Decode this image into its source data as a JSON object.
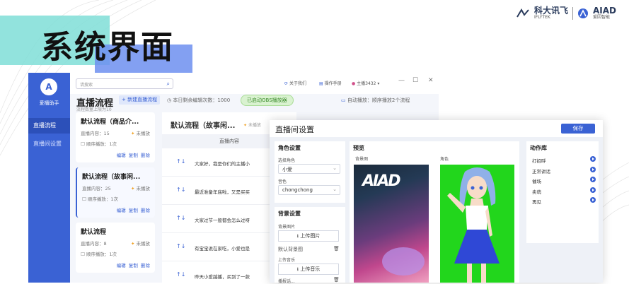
{
  "slide": {
    "title": "系统界面",
    "logo_left_cn": "科大讯飞",
    "logo_left_en": "IFLYTEK",
    "logo_right_en": "AIAD",
    "logo_right_cn": "爱因智能"
  },
  "app": {
    "name": "爱播助手",
    "nav": [
      {
        "label": "直播流程",
        "active": true
      },
      {
        "label": "直播间设置",
        "active": false
      }
    ],
    "search_placeholder": "请搜索",
    "topbar": {
      "about": "关于我们",
      "manual": "操作手册",
      "user": "主播3432"
    },
    "section_title": "直播流程",
    "section_sub": "流程数量上限为10",
    "new_flow_button": "+ 新建直播流程",
    "today_edits": "本日剩余编辑次数：1000",
    "obs_status": "已启动OBS播放器",
    "auto_play": "自动播放：顺序播放2个流程",
    "flows": [
      {
        "title": "默认流程（商品介...",
        "content_count": "直播内容：15",
        "status": "未播放",
        "order": "顺序播放：1次",
        "actions": [
          "编辑",
          "复制",
          "删除"
        ]
      },
      {
        "title": "默认流程（故事闲...",
        "content_count": "直播内容：25",
        "status": "未播放",
        "order": "顺序播放：1次",
        "actions": [
          "编辑",
          "复制",
          "删除"
        ]
      },
      {
        "title": "默认流程",
        "content_count": "直播内容：8",
        "status": "未播放",
        "order": "顺序播放：1次",
        "actions": [
          "编辑",
          "复制",
          "删除"
        ]
      }
    ],
    "playlist": {
      "title": "默认流程（故事闲...",
      "state": "未播放",
      "column": "直播内容",
      "rows": [
        "大家好，我是你们的主播小",
        "最近准备年底啦，又是买买",
        "大家过节一般都会怎么过呀",
        "有宝宝说在家吃，小爱也是",
        "昨天小爱越播，买到了一款"
      ]
    }
  },
  "settings": {
    "title": "直播间设置",
    "save": "保存",
    "role": {
      "heading": "角色设置",
      "role_label": "选择角色",
      "role_value": "小爱",
      "voice_label": "音色",
      "voice_value": "chongchong"
    },
    "bg": {
      "heading": "背景设置",
      "image_label": "背景图片",
      "upload_image": "上传图片",
      "default_bg": "默认背景图",
      "music_label": "上传音乐",
      "upload_music": "上传音乐",
      "last": "播报话..."
    },
    "preview": {
      "heading": "预览",
      "bg_label": "背景图",
      "bg_mark": "AIAD",
      "char_label": "角色"
    },
    "actions": {
      "heading": "动作库",
      "items": [
        "打招呼",
        "正常讲话",
        "催场",
        "卖萌",
        "再见"
      ]
    }
  }
}
